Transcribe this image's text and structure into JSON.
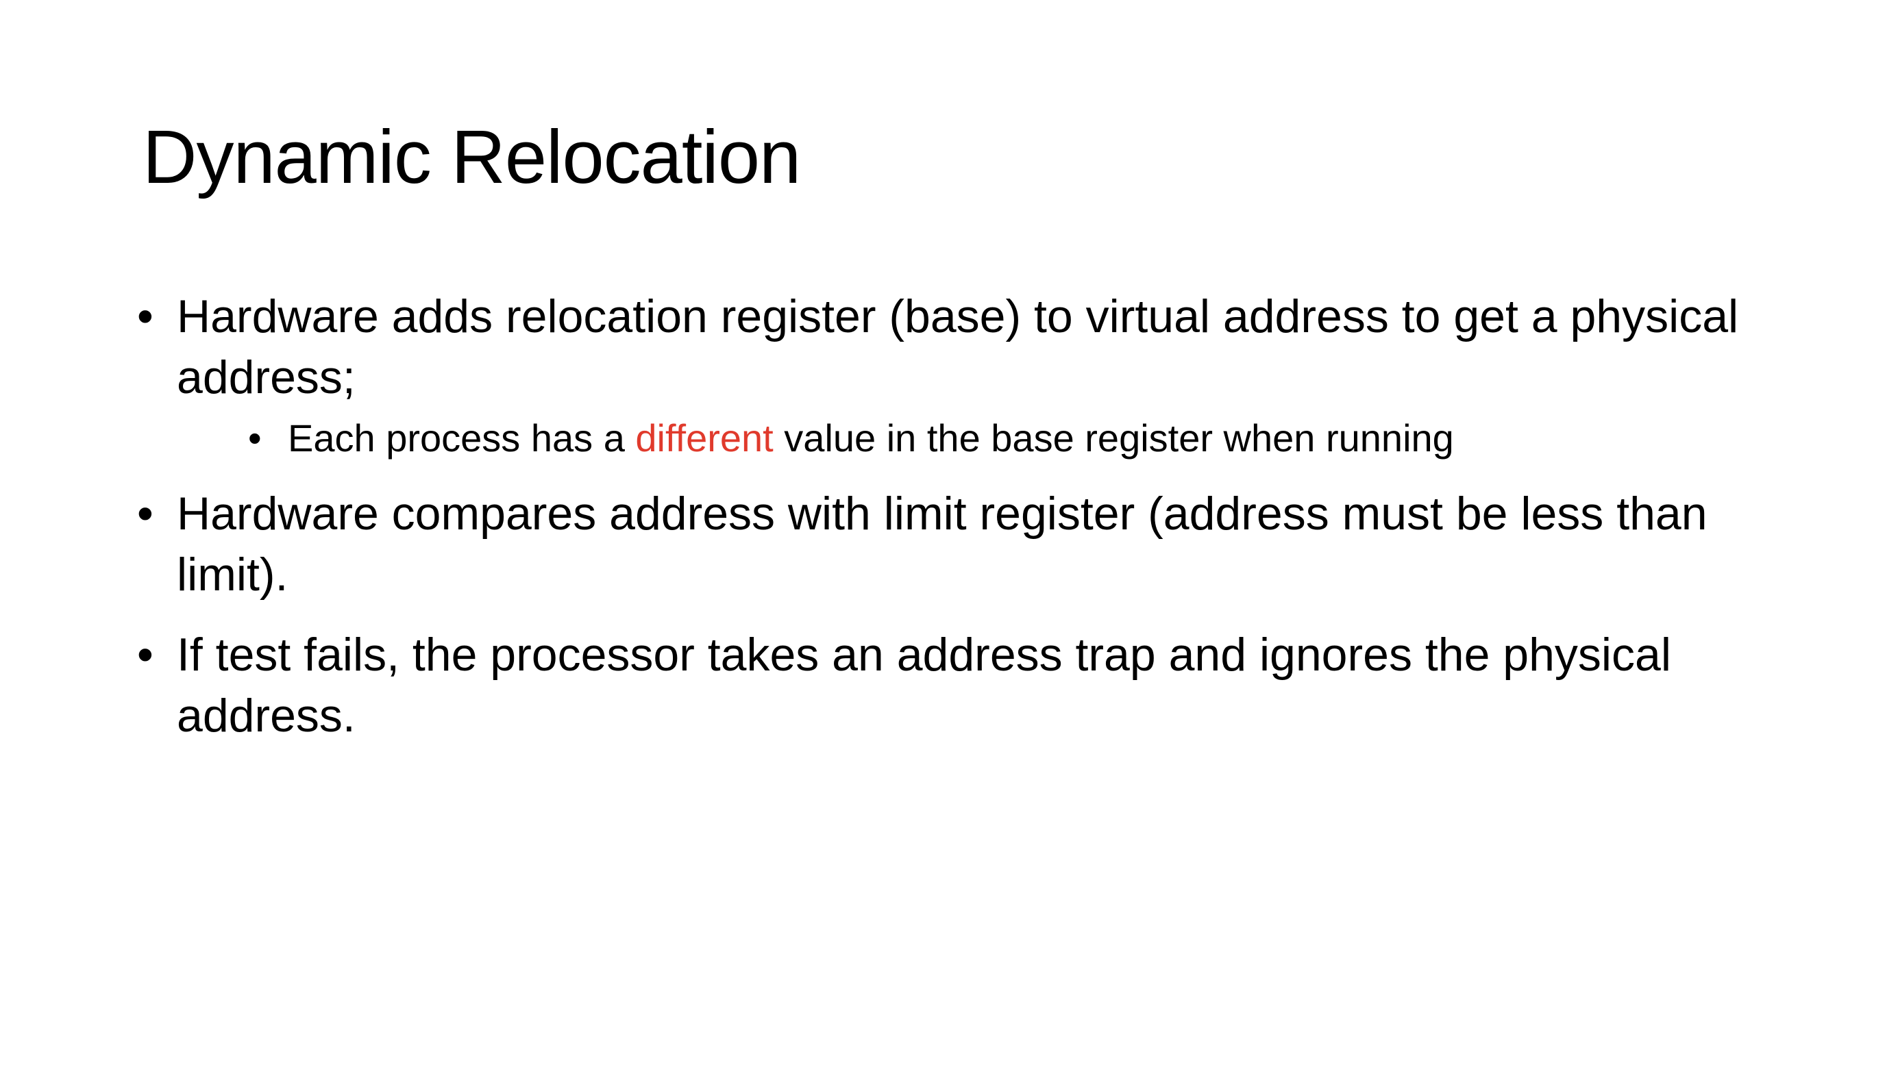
{
  "slide": {
    "title": "Dynamic Relocation",
    "accent_color": "#e03a2c",
    "bullets": [
      {
        "text": "Hardware adds relocation register (base) to virtual address to get a physical address;",
        "sub_bullet": {
          "before": "Each process has a ",
          "emphasis": "different",
          "after": " value in the base register when running"
        }
      },
      {
        "text": "Hardware compares address with limit register (address must be less than limit)."
      },
      {
        "text": "If test fails, the processor takes an address trap and ignores the physical address."
      }
    ],
    "bullet_glyph": "•"
  }
}
